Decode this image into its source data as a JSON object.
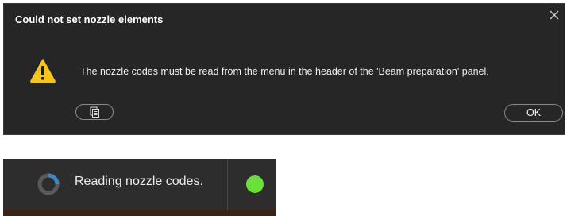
{
  "dialog": {
    "title": "Could not set nozzle elements",
    "message": "The nozzle codes must be read from the menu in the header of the 'Beam preparation' panel.",
    "ok_label": "OK",
    "icons": {
      "close": "close-icon",
      "warning": "warning-icon",
      "copy": "copy-icon"
    },
    "colors": {
      "background": "#262626",
      "warning": "#f5c518"
    }
  },
  "status_bar": {
    "text": "Reading nozzle codes.",
    "indicator_status": "ok",
    "icons": {
      "progress": "spinner-icon"
    },
    "colors": {
      "background": "#2d2d2d",
      "indicator": "#6ce03a"
    }
  }
}
